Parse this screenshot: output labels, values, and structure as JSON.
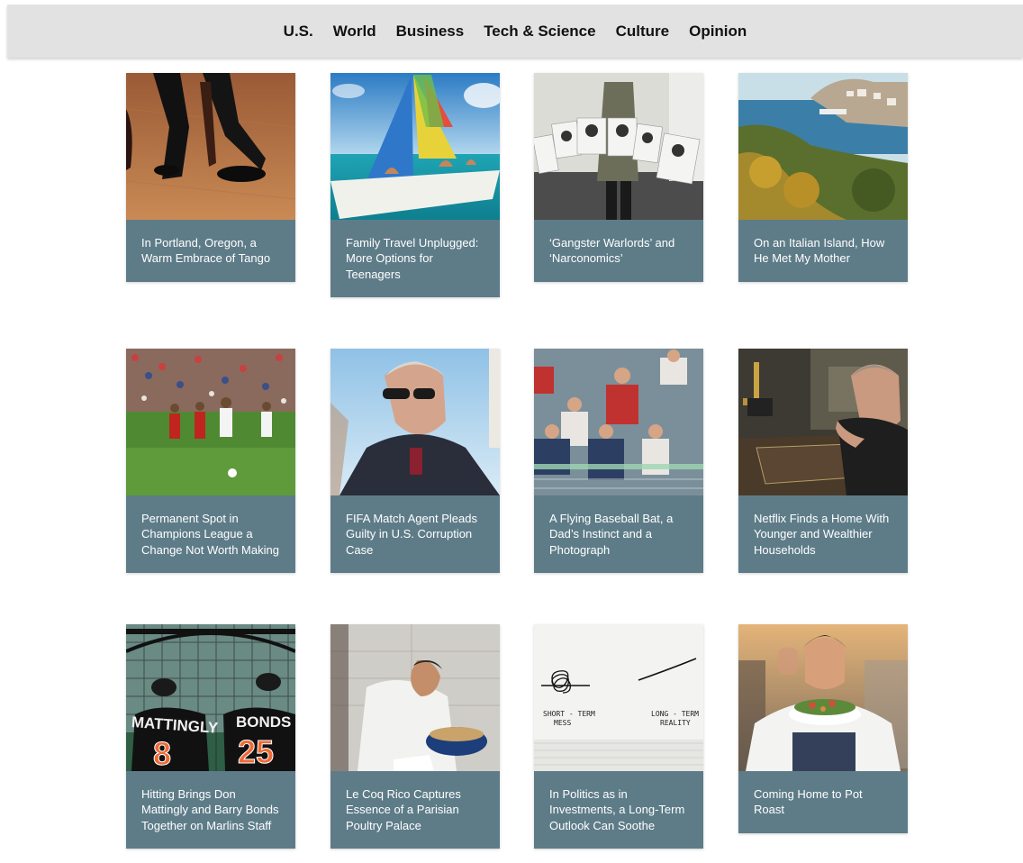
{
  "nav": {
    "items": [
      {
        "label": "U.S."
      },
      {
        "label": "World"
      },
      {
        "label": "Business"
      },
      {
        "label": "Tech & Science"
      },
      {
        "label": "Culture"
      },
      {
        "label": "Opinion"
      }
    ]
  },
  "articles": [
    {
      "title": "In Portland, Oregon, a Warm Embrace of Tango",
      "image": "tango-dancers-photo"
    },
    {
      "title": "Family Travel Unplugged: More Options for Teenagers",
      "image": "catamaran-photo"
    },
    {
      "title": "‘Gangster Warlords’ and ‘Narconomics’",
      "image": "protest-signs-photo"
    },
    {
      "title": "On an Italian Island, How He Met My Mother",
      "image": "italian-island-photo"
    },
    {
      "title": "Permanent Spot in Champions League a Change Not Worth Making",
      "image": "soccer-match-photo"
    },
    {
      "title": "FIFA Match Agent Pleads Guilty in U.S. Corruption Case",
      "image": "man-sunglasses-photo"
    },
    {
      "title": "A Flying Baseball Bat, a Dad’s Instinct and a Photograph",
      "image": "baseball-crowd-photo"
    },
    {
      "title": "Netflix Finds a Home With Younger and Wealthier Households",
      "image": "actor-desk-photo"
    },
    {
      "title": "Hitting Brings Don Mattingly and Barry Bonds Together on Marlins Staff",
      "image": "marlins-batting-cage-photo",
      "jerseys": [
        {
          "name": "MATTINGLY",
          "number": "8"
        },
        {
          "name": "BONDS",
          "number": "25"
        }
      ]
    },
    {
      "title": "Le Coq Rico Captures Essence of a Parisian Poultry Palace",
      "image": "chef-pot-photo"
    },
    {
      "title": "In Politics as in Investments, a Long-Term Outlook Can Soothe",
      "image": "napkin-sketch-photo",
      "sketch": {
        "left_line1": "SHORT - TERM",
        "left_line2": "MESS",
        "right_line1": "LONG - TERM",
        "right_line2": "REALITY"
      }
    },
    {
      "title": "Coming Home to Pot Roast",
      "image": "chef-bowl-photo"
    }
  ],
  "colors": {
    "caption_bg": "#5e7c88",
    "nav_bg": "#e2e2e2"
  }
}
